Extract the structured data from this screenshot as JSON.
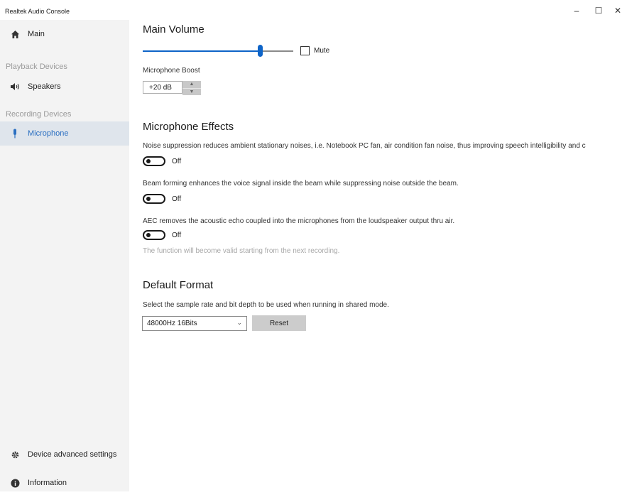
{
  "app": {
    "title": "Realtek Audio Console",
    "window_buttons": {
      "minimize": "–",
      "maximize": "☐",
      "close": "✕"
    }
  },
  "sidebar": {
    "main": {
      "label": "Main",
      "icon": "home-icon"
    },
    "playback_header": "Playback Devices",
    "speakers": {
      "label": "Speakers",
      "icon": "speaker-icon"
    },
    "recording_header": "Recording Devices",
    "microphone": {
      "label": "Microphone",
      "icon": "microphone-icon",
      "selected": true
    },
    "device_advanced": {
      "label": "Device advanced settings",
      "icon": "gear-icon"
    },
    "information": {
      "label": "Information",
      "icon": "info-icon"
    }
  },
  "main_volume": {
    "title": "Main Volume",
    "level_percent": 78,
    "mute_label": "Mute",
    "mute_checked": false
  },
  "boost": {
    "label": "Microphone Boost",
    "value": "+20 dB"
  },
  "effects": {
    "title": "Microphone Effects",
    "noise_suppression": {
      "desc": "Noise suppression reduces ambient stationary noises, i.e. Notebook PC fan, air condition fan noise, thus improving speech intelligibility and c",
      "state": "Off"
    },
    "beam_forming": {
      "desc": "Beam forming enhances the voice signal inside the beam while suppressing noise outside the beam.",
      "state": "Off"
    },
    "aec": {
      "desc": "AEC removes the acoustic echo coupled into the microphones from the loudspeaker output thru air.",
      "state": "Off",
      "note": "The function will become valid starting from the next recording."
    }
  },
  "default_format": {
    "title": "Default Format",
    "desc": "Select the sample rate and bit depth to be used when running in shared mode.",
    "selected": "48000Hz 16Bits",
    "reset_label": "Reset"
  },
  "colors": {
    "accent": "#0e64c8",
    "sidebar_bg": "#f3f3f3",
    "selected_bg": "#dfe5ec"
  }
}
